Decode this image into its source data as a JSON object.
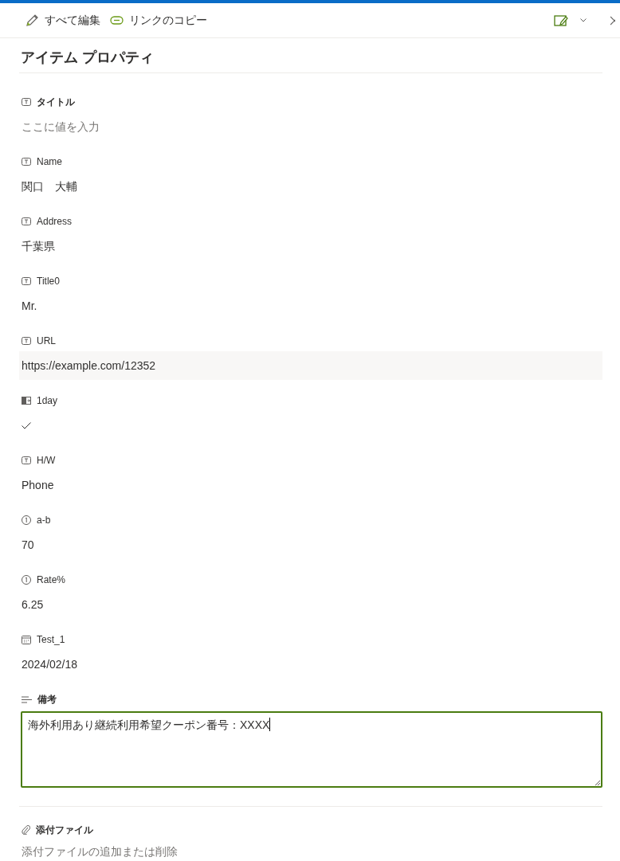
{
  "toolbar": {
    "actions": [
      {
        "kind": "edit",
        "label": "すべて編集"
      },
      {
        "kind": "link",
        "label": "リンクのコピー"
      }
    ]
  },
  "panel": {
    "title": "アイテム プロパティ"
  },
  "fields": [
    {
      "kind": "text",
      "label": "タイトル",
      "required": true,
      "placeholder": "ここに値を入力",
      "highlighted": false
    },
    {
      "kind": "text",
      "label": "Name",
      "required": false,
      "value": "関口　大輔",
      "highlighted": false
    },
    {
      "kind": "text",
      "label": "Address",
      "required": false,
      "value": "千葉県",
      "highlighted": false
    },
    {
      "kind": "text",
      "label": "Title0",
      "required": false,
      "value": "Mr.",
      "highlighted": false
    },
    {
      "kind": "text",
      "label": "URL",
      "required": false,
      "value": "https://example.com/12352",
      "highlighted": true
    },
    {
      "kind": "boolean",
      "label": "1day",
      "required": false,
      "checked": true,
      "highlighted": false
    },
    {
      "kind": "text",
      "label": "H/W",
      "required": false,
      "value": "Phone",
      "highlighted": false
    },
    {
      "kind": "number",
      "label": "a-b",
      "required": false,
      "value": "70",
      "highlighted": false
    },
    {
      "kind": "number",
      "label": "Rate%",
      "required": false,
      "value": "6.25",
      "highlighted": false
    },
    {
      "kind": "date",
      "label": "Test_1",
      "required": false,
      "value": "2024/02/18",
      "highlighted": false
    },
    {
      "kind": "multiline",
      "label": "備考",
      "required": true,
      "value": "海外利用あり継続利用希望クーポン番号：XXXX",
      "focused": true
    }
  ],
  "attachments": {
    "label": "添付ファイル",
    "action": "添付ファイルの追加または削除"
  }
}
